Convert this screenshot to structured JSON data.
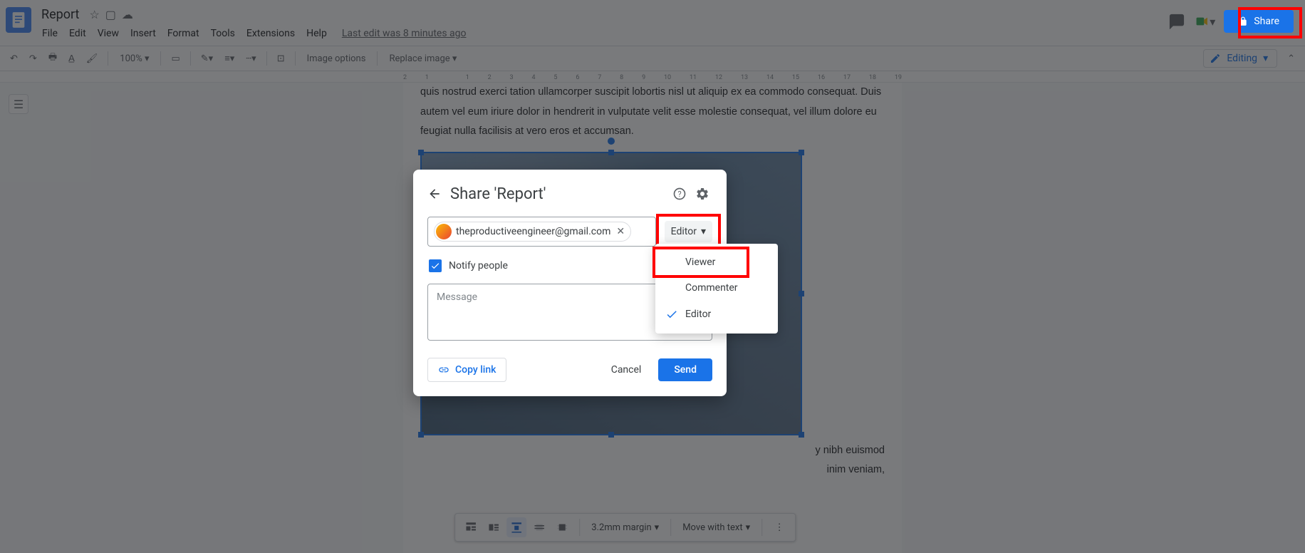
{
  "header": {
    "doc_title": "Report",
    "menus": [
      "File",
      "Edit",
      "View",
      "Insert",
      "Format",
      "Tools",
      "Extensions",
      "Help"
    ],
    "last_edit": "Last edit was 8 minutes ago",
    "share_label": "Share"
  },
  "toolbar": {
    "zoom": "100%",
    "image_options": "Image options",
    "replace_image": "Replace image",
    "editing": "Editing"
  },
  "ruler_marks": [
    "2",
    "1",
    "",
    "1",
    "2",
    "3",
    "4",
    "5",
    "6",
    "7",
    "8",
    "9",
    "10",
    "11",
    "12",
    "13",
    "14",
    "15",
    "16",
    "17",
    "18",
    "19"
  ],
  "document": {
    "para1": "quis nostrud exerci tation ullamcorper suscipit lobortis nisl ut aliquip ex ea commodo consequat. Duis autem vel eum iriure dolor in hendrerit in vulputate velit esse molestie consequat, vel illum dolore eu feugiat nulla facilisis at vero eros et accumsan.",
    "para2_frag": "y nibh euismod",
    "para3_frag": "inim veniam,"
  },
  "float_toolbar": {
    "margin": "3.2mm margin",
    "move_with_text": "Move with text"
  },
  "dialog": {
    "title": "Share 'Report'",
    "chip_email": "theproductiveengineer@gmail.com",
    "role_button": "Editor",
    "notify": "Notify people",
    "message_placeholder": "Message",
    "copy_link": "Copy link",
    "cancel": "Cancel",
    "send": "Send"
  },
  "dropdown": {
    "items": [
      "Viewer",
      "Commenter",
      "Editor"
    ],
    "selected": "Editor"
  }
}
